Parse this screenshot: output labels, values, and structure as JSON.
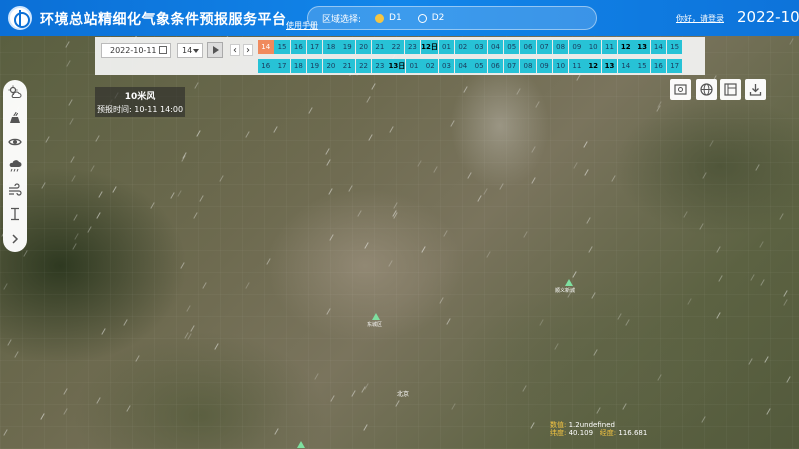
{
  "header": {
    "title": "环境总站精细化气象条件预报服务平台",
    "manual_link": "使用手册",
    "region": {
      "label": "区域选择:",
      "options": [
        {
          "label": "D1",
          "selected": true
        },
        {
          "label": "D2",
          "selected": false
        }
      ]
    },
    "login": "你好，请登录",
    "date": "2022-10-"
  },
  "time_control": {
    "date_value": "2022-10-11",
    "hour_value": "14",
    "row1": [
      "14",
      "15",
      "16",
      "17",
      "18",
      "19",
      "20",
      "21",
      "22",
      "23",
      "12日",
      "01",
      "02",
      "03",
      "04",
      "05",
      "06",
      "07",
      "08",
      "09",
      "10",
      "11",
      "12",
      "13",
      "14",
      "15"
    ],
    "row2": [
      "16",
      "17",
      "18",
      "19",
      "20",
      "21",
      "22",
      "23",
      "13日",
      "01",
      "02",
      "03",
      "04",
      "05",
      "06",
      "07",
      "08",
      "09",
      "10",
      "11",
      "12",
      "13",
      "14",
      "15",
      "16",
      "17"
    ],
    "selected_hour_index": 0,
    "prev_label": "‹",
    "next_label": "›"
  },
  "toolbar": {
    "items": [
      {
        "name": "sun-cloud-icon"
      },
      {
        "name": "pollution-icon"
      },
      {
        "name": "visibility-icon"
      },
      {
        "name": "rain-cloud-icon"
      },
      {
        "name": "wind-icon"
      },
      {
        "name": "height-icon"
      },
      {
        "name": "chevron-right-icon"
      }
    ]
  },
  "wind_panel": {
    "name": "10米风",
    "time": "预报时间: 10-11 14:00"
  },
  "right_tools": [
    {
      "name": "layer-image-icon"
    },
    {
      "name": "globe-icon"
    },
    {
      "name": "chart-panel-icon"
    },
    {
      "name": "download-icon"
    }
  ],
  "map_labels": {
    "station_1": "东城区",
    "station_2": "顺义新城",
    "city": "北京"
  },
  "readout": {
    "line1_key": "数值:",
    "line1_value": "1.2undefined",
    "lat_key": "纬度:",
    "lat_value": "40.109",
    "lon_key": "经度:",
    "lon_value": "116.681"
  },
  "colors": {
    "header": "#0b6fd6",
    "cell": "#27c2d6",
    "cell_selected": "#f08a5d",
    "accent": "#f5c542"
  }
}
